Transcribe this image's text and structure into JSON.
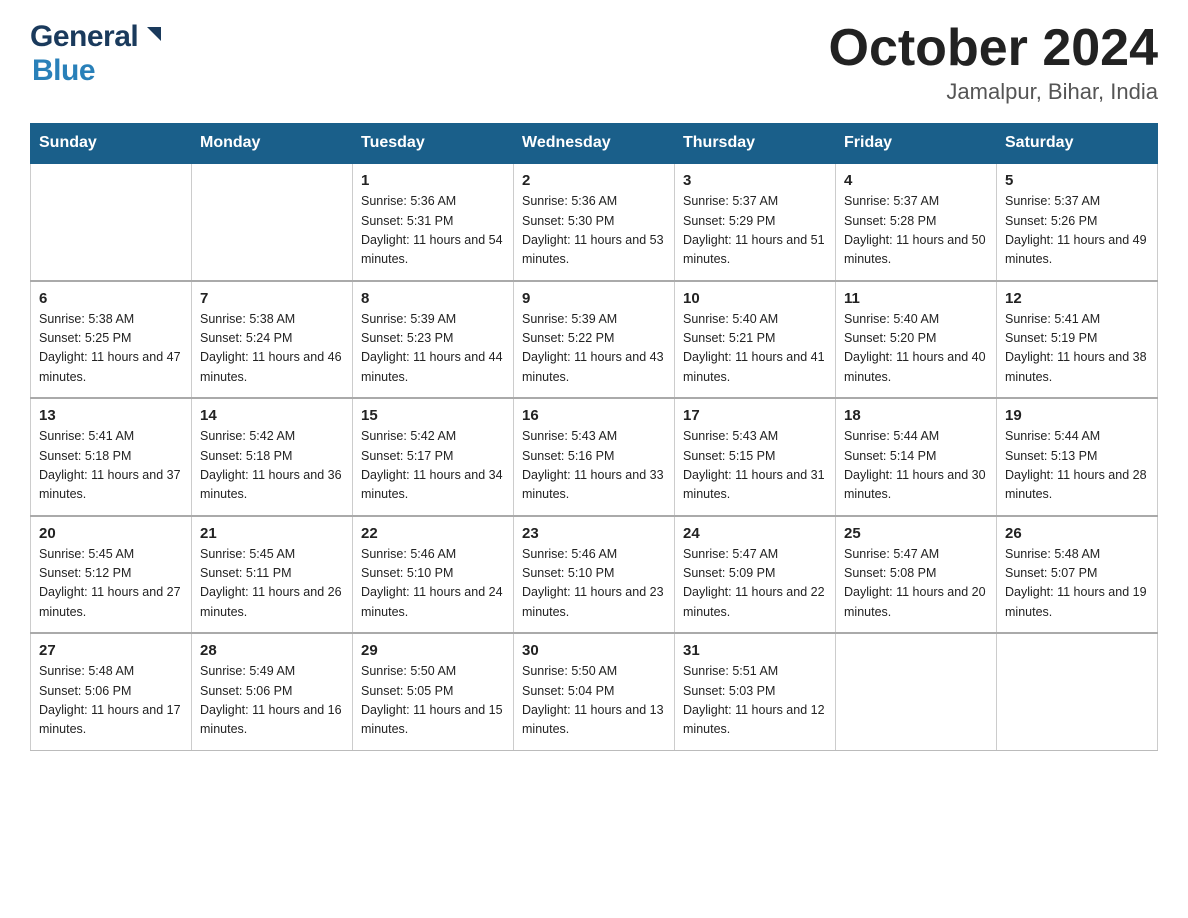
{
  "header": {
    "logo_general": "General",
    "logo_blue": "Blue",
    "month_year": "October 2024",
    "location": "Jamalpur, Bihar, India"
  },
  "days_of_week": [
    "Sunday",
    "Monday",
    "Tuesday",
    "Wednesday",
    "Thursday",
    "Friday",
    "Saturday"
  ],
  "weeks": [
    [
      {
        "day": "",
        "sunrise": "",
        "sunset": "",
        "daylight": ""
      },
      {
        "day": "",
        "sunrise": "",
        "sunset": "",
        "daylight": ""
      },
      {
        "day": "1",
        "sunrise": "Sunrise: 5:36 AM",
        "sunset": "Sunset: 5:31 PM",
        "daylight": "Daylight: 11 hours and 54 minutes."
      },
      {
        "day": "2",
        "sunrise": "Sunrise: 5:36 AM",
        "sunset": "Sunset: 5:30 PM",
        "daylight": "Daylight: 11 hours and 53 minutes."
      },
      {
        "day": "3",
        "sunrise": "Sunrise: 5:37 AM",
        "sunset": "Sunset: 5:29 PM",
        "daylight": "Daylight: 11 hours and 51 minutes."
      },
      {
        "day": "4",
        "sunrise": "Sunrise: 5:37 AM",
        "sunset": "Sunset: 5:28 PM",
        "daylight": "Daylight: 11 hours and 50 minutes."
      },
      {
        "day": "5",
        "sunrise": "Sunrise: 5:37 AM",
        "sunset": "Sunset: 5:26 PM",
        "daylight": "Daylight: 11 hours and 49 minutes."
      }
    ],
    [
      {
        "day": "6",
        "sunrise": "Sunrise: 5:38 AM",
        "sunset": "Sunset: 5:25 PM",
        "daylight": "Daylight: 11 hours and 47 minutes."
      },
      {
        "day": "7",
        "sunrise": "Sunrise: 5:38 AM",
        "sunset": "Sunset: 5:24 PM",
        "daylight": "Daylight: 11 hours and 46 minutes."
      },
      {
        "day": "8",
        "sunrise": "Sunrise: 5:39 AM",
        "sunset": "Sunset: 5:23 PM",
        "daylight": "Daylight: 11 hours and 44 minutes."
      },
      {
        "day": "9",
        "sunrise": "Sunrise: 5:39 AM",
        "sunset": "Sunset: 5:22 PM",
        "daylight": "Daylight: 11 hours and 43 minutes."
      },
      {
        "day": "10",
        "sunrise": "Sunrise: 5:40 AM",
        "sunset": "Sunset: 5:21 PM",
        "daylight": "Daylight: 11 hours and 41 minutes."
      },
      {
        "day": "11",
        "sunrise": "Sunrise: 5:40 AM",
        "sunset": "Sunset: 5:20 PM",
        "daylight": "Daylight: 11 hours and 40 minutes."
      },
      {
        "day": "12",
        "sunrise": "Sunrise: 5:41 AM",
        "sunset": "Sunset: 5:19 PM",
        "daylight": "Daylight: 11 hours and 38 minutes."
      }
    ],
    [
      {
        "day": "13",
        "sunrise": "Sunrise: 5:41 AM",
        "sunset": "Sunset: 5:18 PM",
        "daylight": "Daylight: 11 hours and 37 minutes."
      },
      {
        "day": "14",
        "sunrise": "Sunrise: 5:42 AM",
        "sunset": "Sunset: 5:18 PM",
        "daylight": "Daylight: 11 hours and 36 minutes."
      },
      {
        "day": "15",
        "sunrise": "Sunrise: 5:42 AM",
        "sunset": "Sunset: 5:17 PM",
        "daylight": "Daylight: 11 hours and 34 minutes."
      },
      {
        "day": "16",
        "sunrise": "Sunrise: 5:43 AM",
        "sunset": "Sunset: 5:16 PM",
        "daylight": "Daylight: 11 hours and 33 minutes."
      },
      {
        "day": "17",
        "sunrise": "Sunrise: 5:43 AM",
        "sunset": "Sunset: 5:15 PM",
        "daylight": "Daylight: 11 hours and 31 minutes."
      },
      {
        "day": "18",
        "sunrise": "Sunrise: 5:44 AM",
        "sunset": "Sunset: 5:14 PM",
        "daylight": "Daylight: 11 hours and 30 minutes."
      },
      {
        "day": "19",
        "sunrise": "Sunrise: 5:44 AM",
        "sunset": "Sunset: 5:13 PM",
        "daylight": "Daylight: 11 hours and 28 minutes."
      }
    ],
    [
      {
        "day": "20",
        "sunrise": "Sunrise: 5:45 AM",
        "sunset": "Sunset: 5:12 PM",
        "daylight": "Daylight: 11 hours and 27 minutes."
      },
      {
        "day": "21",
        "sunrise": "Sunrise: 5:45 AM",
        "sunset": "Sunset: 5:11 PM",
        "daylight": "Daylight: 11 hours and 26 minutes."
      },
      {
        "day": "22",
        "sunrise": "Sunrise: 5:46 AM",
        "sunset": "Sunset: 5:10 PM",
        "daylight": "Daylight: 11 hours and 24 minutes."
      },
      {
        "day": "23",
        "sunrise": "Sunrise: 5:46 AM",
        "sunset": "Sunset: 5:10 PM",
        "daylight": "Daylight: 11 hours and 23 minutes."
      },
      {
        "day": "24",
        "sunrise": "Sunrise: 5:47 AM",
        "sunset": "Sunset: 5:09 PM",
        "daylight": "Daylight: 11 hours and 22 minutes."
      },
      {
        "day": "25",
        "sunrise": "Sunrise: 5:47 AM",
        "sunset": "Sunset: 5:08 PM",
        "daylight": "Daylight: 11 hours and 20 minutes."
      },
      {
        "day": "26",
        "sunrise": "Sunrise: 5:48 AM",
        "sunset": "Sunset: 5:07 PM",
        "daylight": "Daylight: 11 hours and 19 minutes."
      }
    ],
    [
      {
        "day": "27",
        "sunrise": "Sunrise: 5:48 AM",
        "sunset": "Sunset: 5:06 PM",
        "daylight": "Daylight: 11 hours and 17 minutes."
      },
      {
        "day": "28",
        "sunrise": "Sunrise: 5:49 AM",
        "sunset": "Sunset: 5:06 PM",
        "daylight": "Daylight: 11 hours and 16 minutes."
      },
      {
        "day": "29",
        "sunrise": "Sunrise: 5:50 AM",
        "sunset": "Sunset: 5:05 PM",
        "daylight": "Daylight: 11 hours and 15 minutes."
      },
      {
        "day": "30",
        "sunrise": "Sunrise: 5:50 AM",
        "sunset": "Sunset: 5:04 PM",
        "daylight": "Daylight: 11 hours and 13 minutes."
      },
      {
        "day": "31",
        "sunrise": "Sunrise: 5:51 AM",
        "sunset": "Sunset: 5:03 PM",
        "daylight": "Daylight: 11 hours and 12 minutes."
      },
      {
        "day": "",
        "sunrise": "",
        "sunset": "",
        "daylight": ""
      },
      {
        "day": "",
        "sunrise": "",
        "sunset": "",
        "daylight": ""
      }
    ]
  ]
}
